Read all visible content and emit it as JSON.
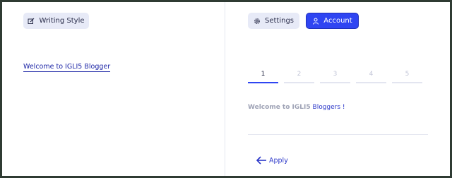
{
  "left": {
    "writing_style_label": "Writing Style",
    "welcome_link": "Welcome to IGLI5 Blogger"
  },
  "toolbar": {
    "settings_label": "Settings",
    "account_label": "Account"
  },
  "steps": [
    {
      "label": "1",
      "active": true
    },
    {
      "label": "2",
      "active": false
    },
    {
      "label": "3",
      "active": false
    },
    {
      "label": "4",
      "active": false
    },
    {
      "label": "5",
      "active": false
    }
  ],
  "welcome_message": {
    "prefix": "Welcome to IGLI5",
    "highlight": "Bloggers !"
  },
  "apply_label": "Apply",
  "icons": {
    "writing_style": "edit-icon",
    "settings": "gear-icon",
    "account": "user-icon",
    "apply": "arrow-left-icon"
  },
  "colors": {
    "primary": "#2f45f2",
    "pill_light": "#e7eaf7",
    "link": "#1c25a6"
  }
}
